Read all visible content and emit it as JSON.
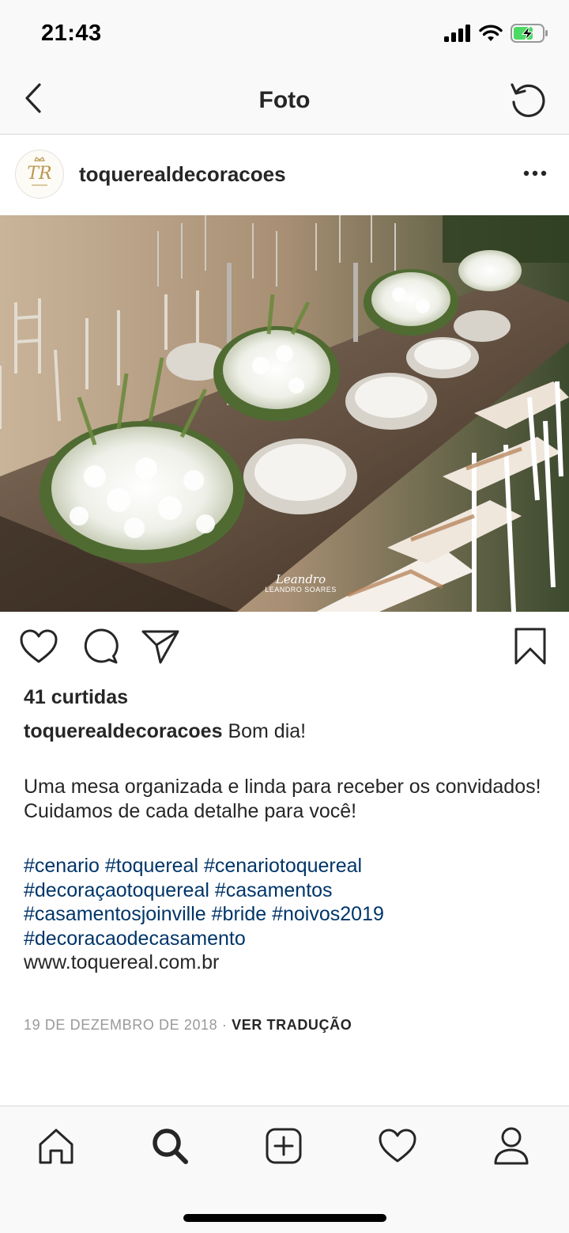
{
  "status_bar": {
    "time": "21:43",
    "icons": [
      "cellular-signal-icon",
      "wifi-icon",
      "battery-charging-icon"
    ]
  },
  "nav": {
    "title": "Foto",
    "back_icon": "chevron-left-icon",
    "refresh_icon": "refresh-icon"
  },
  "post": {
    "avatar_text": "TR",
    "username": "toquerealdecoracoes",
    "more_icon": "more-horizontal-icon",
    "photo": {
      "watermark_script": "Leandro",
      "watermark_name": "LEANDRO SOARES"
    },
    "actions": {
      "like_icon": "heart-icon",
      "comment_icon": "comment-icon",
      "share_icon": "paper-plane-icon",
      "save_icon": "bookmark-icon"
    },
    "likes": "41 curtidas",
    "caption": {
      "username": "toquerealdecoracoes",
      "first_line": "Bom dia!",
      "body_line1": "Uma mesa organizada e linda para receber os convidados!",
      "body_line2": "Cuidamos de cada detalhe para você!",
      "hashtags": [
        "#cenario",
        "#toquereal",
        "#cenariotoquereal",
        "#decoraçaotoquereal",
        "#casamentos",
        "#casamentosjoinville",
        "#bride",
        "#noivos2019",
        "#decoracaodecasamento"
      ],
      "website": "www.toquereal.com.br"
    },
    "date": "19 DE DEZEMBRO DE 2018",
    "separator": "·",
    "translate": "VER TRADUÇÃO"
  },
  "tab_bar": {
    "items": [
      "home-icon",
      "search-icon",
      "new-post-icon",
      "activity-heart-icon",
      "profile-icon"
    ]
  },
  "colors": {
    "text": "#262626",
    "hashtag": "#003569",
    "muted": "#999999",
    "bar_bg": "#f9f9f9",
    "divider": "#d8d8d8"
  }
}
